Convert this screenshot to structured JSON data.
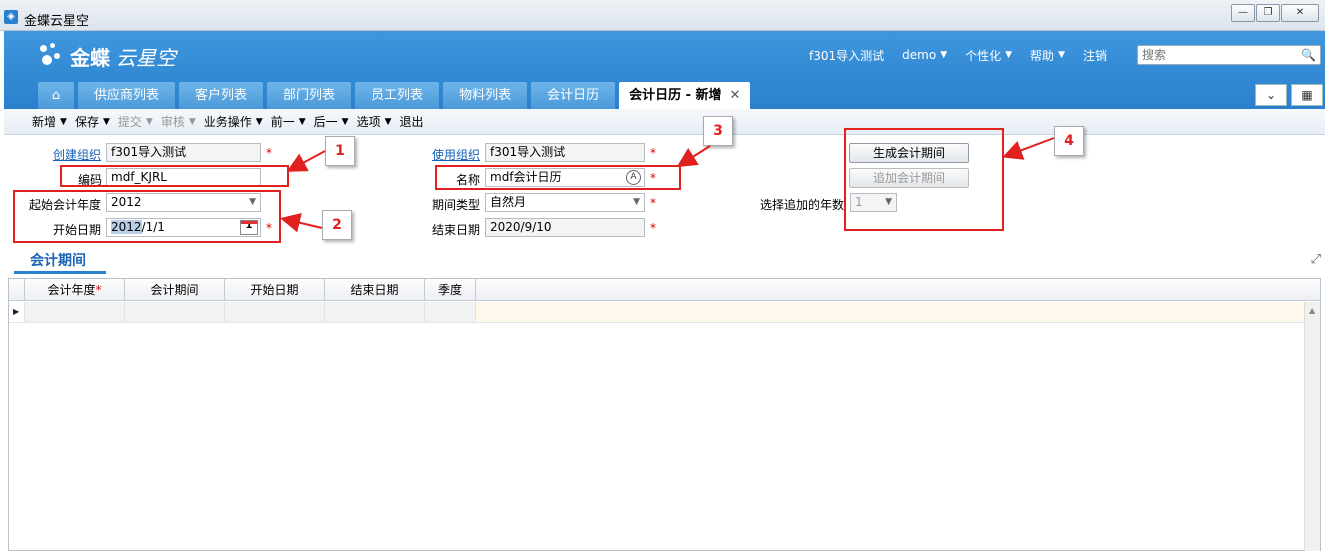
{
  "window": {
    "title": "金蝶云星空",
    "buttons": [
      "—",
      "❐",
      "✕"
    ]
  },
  "brand": {
    "name": "金蝶",
    "name2": "云星空"
  },
  "topnav": {
    "org": "f301导入测试",
    "user": "demo",
    "personalize": "个性化",
    "help": "帮助",
    "logout": "注销",
    "search_placeholder": "搜索"
  },
  "tabs": [
    {
      "label": "供应商列表"
    },
    {
      "label": "客户列表"
    },
    {
      "label": "部门列表"
    },
    {
      "label": "员工列表"
    },
    {
      "label": "物料列表"
    },
    {
      "label": "会计日历"
    },
    {
      "label": "会计日历 - 新增",
      "active": true
    }
  ],
  "toolbar": {
    "new": "新增",
    "save": "保存",
    "submit": "提交",
    "audit": "审核",
    "business": "业务操作",
    "prev": "前一",
    "next": "后一",
    "options": "选项",
    "exit": "退出"
  },
  "form": {
    "create_org_label": "创建组织",
    "create_org_value": "f301导入测试",
    "code_label": "编码",
    "code_value": "mdf_KJRL",
    "start_year_label": "起始会计年度",
    "start_year_value": "2012",
    "start_date_label": "开始日期",
    "start_date_sel": "2012",
    "start_date_rest": "/1/1",
    "use_org_label": "使用组织",
    "use_org_value": "f301导入测试",
    "name_label": "名称",
    "name_value": "mdf会计日历",
    "period_type_label": "期间类型",
    "period_type_value": "自然月",
    "end_date_label": "结束日期",
    "end_date_value": "2020/9/10",
    "generate_button": "生成会计期间",
    "append_button": "追加会计期间",
    "append_years_label": "选择追加的年数",
    "append_years_value": "1",
    "required_mark": "*",
    "calendar_day": "1"
  },
  "callouts": [
    "1",
    "2",
    "3",
    "4"
  ],
  "section_tab": "会计期间",
  "grid": {
    "columns": [
      "会计年度",
      "会计期间",
      "开始日期",
      "结束日期",
      "季度"
    ],
    "required_mark": "*"
  },
  "colors": {
    "header_blue": "#2a80cc",
    "annotation_red": "#e12020",
    "required_red": "#d00"
  }
}
